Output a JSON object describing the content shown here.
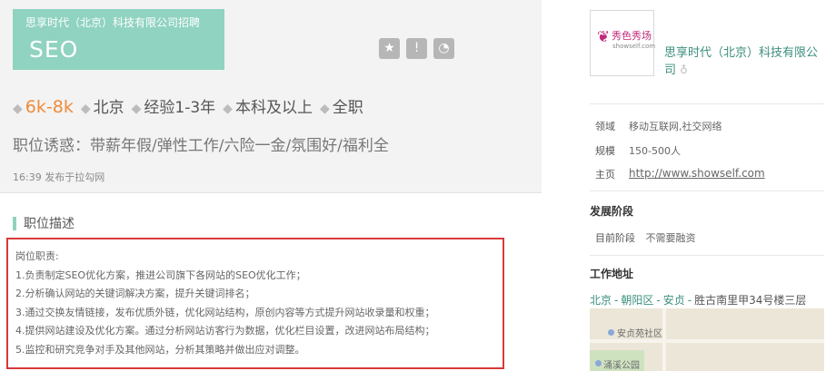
{
  "job": {
    "company_recruit": "思享时代（北京）科技有限公司招聘",
    "title": "SEO",
    "actions": [
      {
        "icon": "star-icon",
        "glyph": "★"
      },
      {
        "icon": "report-warning-icon",
        "glyph": "!"
      },
      {
        "icon": "wechat-icon",
        "glyph": "◔"
      }
    ],
    "tags": [
      "6k-8k",
      "北京",
      "经验1-3年",
      "本科及以上",
      "全职"
    ],
    "temptation": "职位诱惑：带薪年假/弹性工作/六险一金/氛围好/福利全",
    "publish_time": "16:39",
    "publish_source": "发布于拉勾网"
  },
  "description": {
    "heading": "职位描述",
    "lines": [
      "岗位职责:",
      "1.负责制定SEO优化方案，推进公司旗下各网站的SEO优化工作；",
      "2.分析确认网站的关键词解决方案，提升关键词排名；",
      "3.通过交换友情链接，发布优质外链，优化网站结构，原创内容等方式提升网站收录量和权重；",
      "4.提供网站建设及优化方案。通过分析网站访客行为数据，优化栏目设置，改进网站布局结构；",
      "5.监控和研究竞争对手及其他网站，分析其策略并做出应对调整。"
    ]
  },
  "company": {
    "logo_cn": "秀色秀场",
    "logo_en": "showself.com",
    "name": "思享时代（北京）科技有限公司",
    "field_label": "领域",
    "field_value": "移动互联网,社交网络",
    "scale_label": "规模",
    "scale_value": "150-500人",
    "homepage_label": "主页",
    "homepage_value": "http://www.showself.com",
    "stage_heading": "发展阶段",
    "stage_label": "目前阶段",
    "stage_value": "不需要融资",
    "address_heading": "工作地址",
    "address_links": [
      "北京",
      "朝阳区",
      "安贞"
    ],
    "address_text": "胜古南里甲34号楼三层",
    "map_labels": [
      "安贞苑社区",
      "涌溪公园"
    ]
  },
  "colors": {
    "accent_teal": "#8fd3c0",
    "salary_orange": "#f08b3a",
    "highlight_red": "#d83a3a",
    "link_green": "#3c8f7d"
  }
}
